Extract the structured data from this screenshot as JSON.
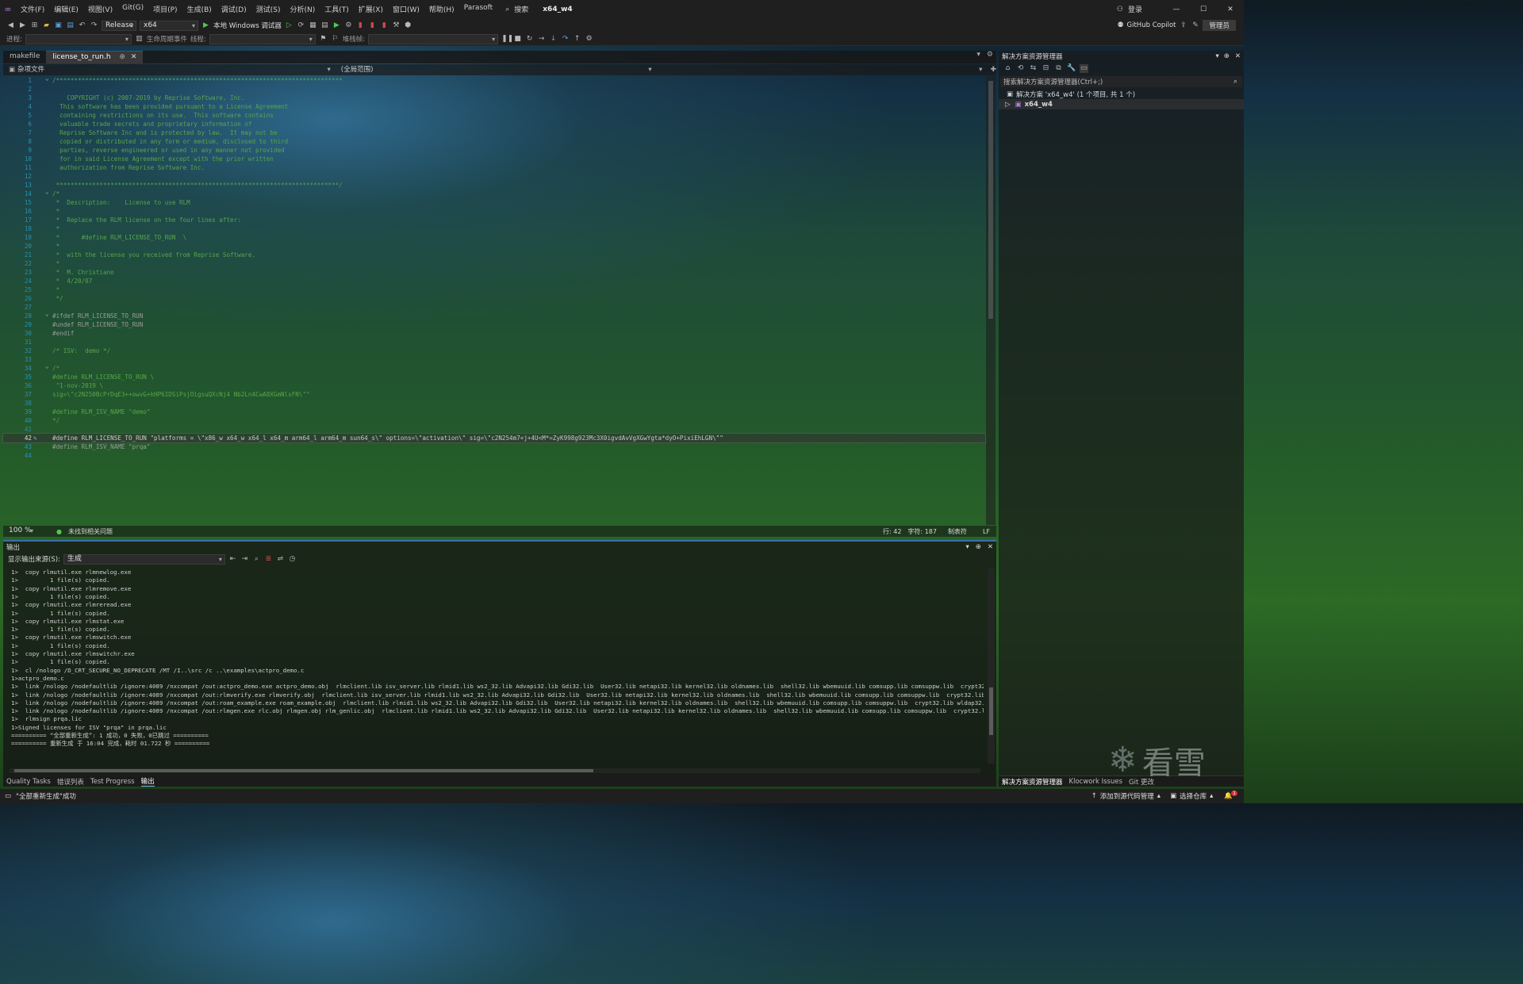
{
  "menubar": {
    "items": [
      "文件(F)",
      "编辑(E)",
      "视图(V)",
      "Git(G)",
      "项目(P)",
      "生成(B)",
      "调试(D)",
      "测试(S)",
      "分析(N)",
      "工具(T)",
      "扩展(X)",
      "窗口(W)",
      "帮助(H)",
      "Parasoft"
    ],
    "search": "搜索",
    "solution_name": "x64_w4",
    "login": "登录"
  },
  "toolbar": {
    "config": "Release",
    "platform": "x64",
    "run_target": "本地 Windows 调试器",
    "copilot": "GitHub Copilot",
    "admin": "管理员"
  },
  "toolbar2": {
    "process_label": "进程:",
    "lifecycle_label": "生命周期事件",
    "thread_label": "线程:",
    "stack_label": "堆栈帧:"
  },
  "tabs": [
    {
      "label": "makefile",
      "active": false
    },
    {
      "label": "license_to_run.h",
      "active": true
    }
  ],
  "navbar": {
    "project": "杂项文件",
    "scope": "(全局范围)"
  },
  "code_lines": [
    {
      "n": "1",
      "t": "/*******************************************************************************",
      "k": "c"
    },
    {
      "n": "2",
      "t": "",
      "k": "c"
    },
    {
      "n": "3",
      "t": "    COPYRIGHT (c) 2007-2019 by Reprise Software, Inc.",
      "k": "c"
    },
    {
      "n": "4",
      "t": "  This software has been provided pursuant to a License Agreement",
      "k": "c"
    },
    {
      "n": "5",
      "t": "  containing restrictions on its use.  This software contains",
      "k": "c"
    },
    {
      "n": "6",
      "t": "  valuable trade secrets and proprietary information of",
      "k": "c"
    },
    {
      "n": "7",
      "t": "  Reprise Software Inc and is protected by law.  It may not be",
      "k": "c"
    },
    {
      "n": "8",
      "t": "  copied or distributed in any form or medium, disclosed to third",
      "k": "c"
    },
    {
      "n": "9",
      "t": "  parties, reverse engineered or used in any manner not provided",
      "k": "c"
    },
    {
      "n": "10",
      "t": "  for in said License Agreement except with the prior written",
      "k": "c"
    },
    {
      "n": "11",
      "t": "  authorization from Reprise Software Inc.",
      "k": "c"
    },
    {
      "n": "12",
      "t": "",
      "k": "c"
    },
    {
      "n": "13",
      "t": " ******************************************************************************/",
      "k": "c"
    },
    {
      "n": "14",
      "t": "/*",
      "k": "c"
    },
    {
      "n": "15",
      "t": " *  Description:    License to use RLM",
      "k": "c"
    },
    {
      "n": "16",
      "t": " *",
      "k": "c"
    },
    {
      "n": "17",
      "t": " *  Replace the RLM license on the four lines after:",
      "k": "c"
    },
    {
      "n": "18",
      "t": " *",
      "k": "c"
    },
    {
      "n": "19",
      "t": " *      #define RLM_LICENSE_TO_RUN  \\",
      "k": "c"
    },
    {
      "n": "20",
      "t": " *",
      "k": "c"
    },
    {
      "n": "21",
      "t": " *  with the license you received from Reprise Software.",
      "k": "c"
    },
    {
      "n": "22",
      "t": " *",
      "k": "c"
    },
    {
      "n": "23",
      "t": " *  M. Christiano",
      "k": "c"
    },
    {
      "n": "24",
      "t": " *  4/20/07",
      "k": "c"
    },
    {
      "n": "25",
      "t": " *",
      "k": "c"
    },
    {
      "n": "26",
      "t": " */",
      "k": "c"
    },
    {
      "n": "27",
      "t": "",
      "k": "c"
    },
    {
      "n": "28",
      "t": "#ifdef RLM_LICENSE_TO_RUN",
      "k": "p"
    },
    {
      "n": "29",
      "t": "#undef RLM_LICENSE_TO_RUN",
      "k": "p"
    },
    {
      "n": "30",
      "t": "#endif",
      "k": "p"
    },
    {
      "n": "31",
      "t": "",
      "k": "c"
    },
    {
      "n": "32",
      "t": "/* ISV:  demo */",
      "k": "c"
    },
    {
      "n": "33",
      "t": "",
      "k": "c"
    },
    {
      "n": "34",
      "t": "/*",
      "k": "c"
    },
    {
      "n": "35",
      "t": "#define RLM_LICENSE_TO_RUN \\",
      "k": "c"
    },
    {
      "n": "36",
      "t": " \"1-nov-2019 \\",
      "k": "c"
    },
    {
      "n": "37",
      "t": "sig=\\\"c2N250BcPrDqE3++owvG+kHP6IDSiPsjOigsuQXcNj4 Nb2Ln4CwA8XGmNlsFN\\\"\"",
      "k": "c"
    },
    {
      "n": "38",
      "t": "",
      "k": "c"
    },
    {
      "n": "39",
      "t": "#define RLM_ISV_NAME \"demo\"",
      "k": "c"
    },
    {
      "n": "40",
      "t": "*/",
      "k": "c"
    },
    {
      "n": "41",
      "t": "",
      "k": "c"
    },
    {
      "n": "42",
      "t": "#define RLM_LICENSE_TO_RUN \"platforms = \\\"x86_w x64_w x64_l x64_m arm64_l arm64_m sun64_s\\\" options=\\\"activation\\\" sig=\\\"c2N254m7+j+4U<M*=ZyK998g923Mc3X0igvdAvVgXGwYgta*dyO+PixiEhLGN\\\"\"",
      "k": "x"
    },
    {
      "n": "43",
      "t": "#define RLM_ISV_NAME \"prqa\"",
      "k": "p"
    },
    {
      "n": "44",
      "t": "",
      "k": "c"
    }
  ],
  "editor_status": {
    "zoom": "100 %",
    "issues": "未找到相关问题",
    "line": "行: 42",
    "char": "字符: 187",
    "tab": "制表符",
    "eol": "LF"
  },
  "solution_explorer": {
    "title": "解决方案资源管理器",
    "search_placeholder": "搜索解决方案资源管理器(Ctrl+;)",
    "solution_label": "解决方案 'x64_w4' (1 个项目, 共 1 个)",
    "project": "x64_w4"
  },
  "output": {
    "title": "输出",
    "source_label": "显示输出来源(S):",
    "source": "生成",
    "lines": [
      "1>  copy rlmutil.exe rlmnewlog.exe",
      "1>         1 file(s) copied.",
      "1>  copy rlmutil.exe rlmremove.exe",
      "1>         1 file(s) copied.",
      "1>  copy rlmutil.exe rlmreread.exe",
      "1>         1 file(s) copied.",
      "1>  copy rlmutil.exe rlmstat.exe",
      "1>         1 file(s) copied.",
      "1>  copy rlmutil.exe rlmswitch.exe",
      "1>         1 file(s) copied.",
      "1>  copy rlmutil.exe rlmswitchr.exe",
      "1>         1 file(s) copied.",
      "1>  cl /nologo /D_CRT_SECURE_NO_DEPRECATE /MT /I..\\src /c ..\\examples\\actpro_demo.c",
      "1>actpro_demo.c",
      "1>  link /nologo /nodefaultlib /ignore:4089 /nxcompat /out:actpro_demo.exe actpro_demo.obj  rlmclient.lib isv_server.lib rlmid1.lib ws2_32.lib Advapi32.lib Gdi32.lib  User32.lib netapi32.lib kernel32.lib oldnames.lib  shell32.lib wbemuuid.lib comsupp.lib comsuppw.lib  crypt32.li",
      "1>  link /nologo /nodefaultlib /ignore:4089 /nxcompat /out:rlmverify.exe rlmverify.obj  rlmclient.lib isv_server.lib rlmid1.lib ws2_32.lib Advapi32.lib Gdi32.lib  User32.lib netapi32.lib kernel32.lib oldnames.lib  shell32.lib wbemuuid.lib comsupp.lib comsuppw.lib  crypt32.lib w",
      "1>  link /nologo /nodefaultlib /ignore:4089 /nxcompat /out:roam_example.exe roam_example.obj  rlmclient.lib rlmid1.lib ws2_32.lib Advapi32.lib Gdi32.lib  User32.lib netapi32.lib kernel32.lib oldnames.lib  shell32.lib wbemuuid.lib comsupp.lib comsuppw.lib  crypt32.lib wldap32.li",
      "1>  link /nologo /nodefaultlib /ignore:4089 /nxcompat /out:rlmgen.exe rlc.obj rlmgen.obj rlm_genlic.obj  rlmclient.lib rlmid1.lib ws2_32.lib Advapi32.lib Gdi32.lib  User32.lib netapi32.lib kernel32.lib oldnames.lib  shell32.lib wbemuuid.lib comsupp.lib comsuppw.lib  crypt32.lib",
      "1>  rlmsign prqa.lic",
      "1>Signed licenses for ISV \"prqa\" in prqa.lic",
      "========== “全部重新生成”: 1 成功，0 失败，0已跳过 ==========",
      "========== 重新生成 于 16:04 完成，耗时 01.722 秒 =========="
    ]
  },
  "bottom_tabs": [
    "Quality Tasks",
    "错误列表",
    "Test Progress",
    "输出"
  ],
  "right_bottom_tabs": [
    "解决方案资源管理器",
    "Klocwork Issues",
    "Git 更改"
  ],
  "statusbar": {
    "message": "\"全部重新生成\"成功",
    "source_control": "添加到源代码管理",
    "repo": "选择仓库",
    "notifications": "1"
  },
  "watermark": "看雪"
}
